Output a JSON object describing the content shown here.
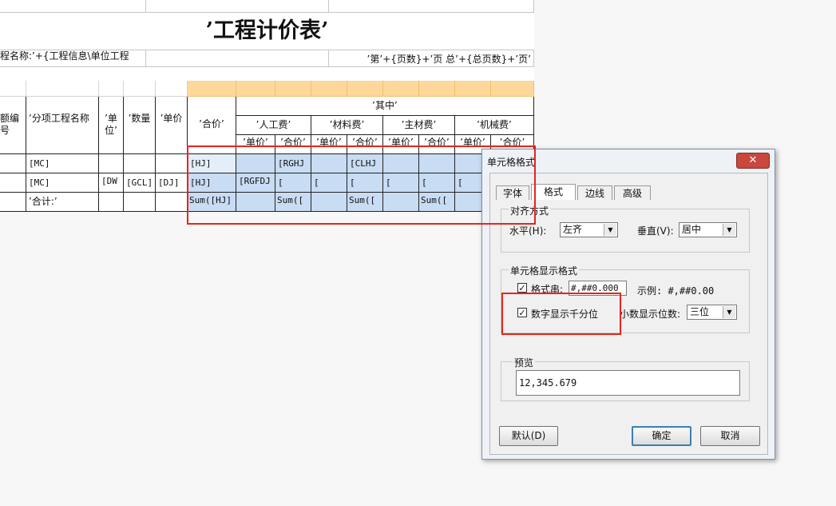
{
  "report": {
    "title": "’工程计价表’",
    "project_label": "程名称:’+{工程信息\\单位工程",
    "page_info": "’第’+{页数}+’页 总’+{总页数}+’页’",
    "headers": {
      "code": "额编号",
      "item_name": "’分项工程名称",
      "unit": "’单位’",
      "qty": "’数量",
      "price": "’单价",
      "total": "’合价’",
      "of_which": "’其中’",
      "labor": "’人工费’",
      "material": "’材料费’",
      "main_material": "’主材费’",
      "machine": "’机械费’",
      "sub_unit": "’单价’",
      "sub_total": "’合价’"
    },
    "rows": [
      {
        "code": "",
        "name": "[MC]",
        "unit": "",
        "qty": "",
        "price": "",
        "total": "[HJ]",
        "c1": "",
        "c2": "[RGHJ",
        "c3": "",
        "c4": "[CLHJ",
        "c5": "",
        "c6": "",
        "c7": "",
        "c8": ""
      },
      {
        "code": "",
        "name": "[MC]",
        "unit": "[DW",
        "qty": "[GCL]",
        "price": "[DJ]",
        "total": "[HJ]",
        "c1": "[RGFDJ",
        "c2": "[",
        "c3": "[",
        "c4": "[",
        "c5": "[",
        "c6": "[",
        "c7": "[",
        "c8": ""
      },
      {
        "code": "",
        "name": "’合计:’",
        "unit": "",
        "qty": "",
        "price": "",
        "total": "Sum([HJ]",
        "c1": "",
        "c2": "Sum([",
        "c3": "",
        "c4": "Sum([",
        "c5": "",
        "c6": "Sum([",
        "c7": "",
        "c8": ""
      }
    ]
  },
  "dialog": {
    "title": "单元格格式",
    "close_label": "✕",
    "tabs": [
      "字体",
      "格式",
      "边线",
      "高级"
    ],
    "align": {
      "group_label": "对齐方式",
      "h_label": "水平(H):",
      "h_value": "左齐",
      "v_label": "垂直(V):",
      "v_value": "居中"
    },
    "display": {
      "group_label": "单元格显示格式",
      "format_label": "格式串:",
      "format_value": "#,##0.000",
      "example_label": "示例: #,##0.00",
      "thousands_label": "数字显示千分位",
      "decimal_label": "小数显示位数:",
      "decimal_value": "三位"
    },
    "preview": {
      "group_label": "预览",
      "value": "12,345.679"
    },
    "buttons": {
      "default": "默认(D)",
      "ok": "确定",
      "cancel": "取消"
    }
  },
  "colors": {
    "highlight": "#e5261d",
    "selection": "#c8dcf3",
    "header_band": "#fdd89a"
  }
}
